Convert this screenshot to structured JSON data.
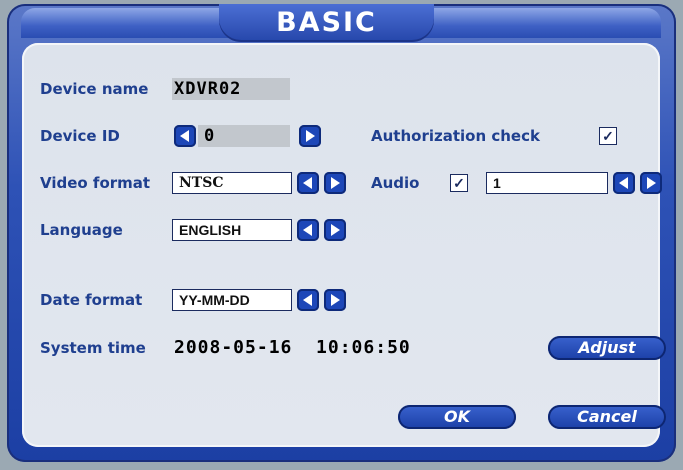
{
  "title": "BASIC",
  "device_name": {
    "label": "Device name",
    "value": "XDVR02"
  },
  "device_id": {
    "label": "Device ID",
    "value": "0"
  },
  "authorization_check": {
    "label": "Authorization check",
    "checked": true,
    "mark": "✓"
  },
  "video_format": {
    "label": "Video format",
    "value": "NTSC"
  },
  "audio": {
    "label": "Audio",
    "checked": true,
    "mark": "✓",
    "channel": "1"
  },
  "language": {
    "label": "Language",
    "value": "ENGLISH"
  },
  "date_format": {
    "label": "Date format",
    "value": "YY-MM-DD"
  },
  "system_time": {
    "label": "System time",
    "value": "2008-05-16  10:06:50"
  },
  "buttons": {
    "adjust": "Adjust",
    "ok": "OK",
    "cancel": "Cancel"
  }
}
